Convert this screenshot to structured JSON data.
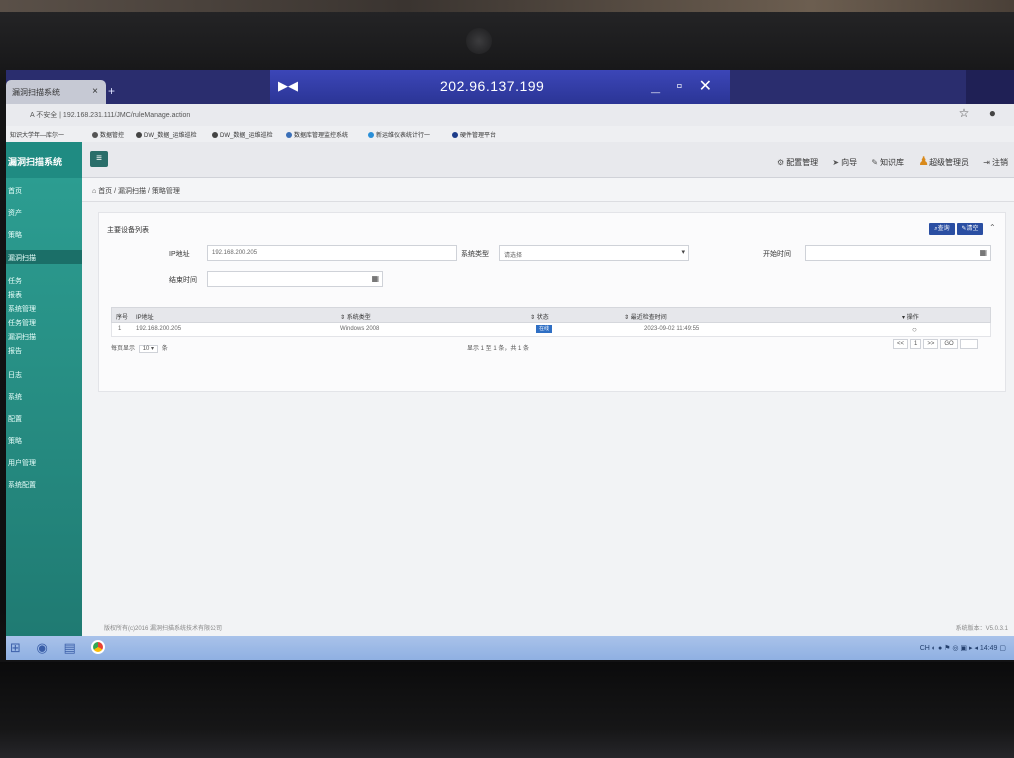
{
  "remote": {
    "ip": "202.96.137.199",
    "pin_icon": "pin-icon"
  },
  "browser": {
    "tab_title": "漏洞扫描系统",
    "url": "A 不安全 | 192.168.231.111/JMC/ruleManage.action",
    "bookmarks": [
      "知识大学年—库尔一",
      "数据管控",
      "DW_数据_运维巡检",
      "DW_数据_运维巡检",
      "数据库管理监控系统",
      "新运维仪表统计行一",
      "硬件管理平台"
    ]
  },
  "app": {
    "brand": "漏洞扫描系统",
    "header_links": [
      "配置管理",
      "向导",
      "知识库",
      "超级管理员",
      "注销"
    ],
    "breadcrumb": "首页 / 漏洞扫描 / 策略管理",
    "sidebar": [
      "首页",
      "资产",
      "策略",
      "漏洞扫描",
      "任务",
      "报表",
      "系统管理",
      "任务管理",
      "漏洞扫描",
      "报告",
      "日志",
      "系统",
      "配置",
      "策略",
      "用户管理",
      "系统配置"
    ]
  },
  "panel": {
    "title": "主要设备列表",
    "query_label": "查询",
    "clear_label": "清空",
    "ip_label": "IP地址",
    "ip_value": "192.168.200.205",
    "sys_label": "系统类型",
    "sys_value": "请选择",
    "start_label": "开始时间",
    "end_label": "结束时间"
  },
  "table": {
    "headers": [
      "序号",
      "IP地址",
      "系统类型",
      "状态",
      "最近检查时间",
      "操作"
    ],
    "rows": [
      {
        "no": "1",
        "ip": "192.168.200.205",
        "os": "Windows 2008",
        "status": "在线",
        "time": "2023-09-02 11:49:55",
        "op": "○"
      }
    ],
    "page_size_label": "每页显示",
    "page_size": "10",
    "page_unit": "条",
    "summary": "显示 1 至 1 条，共 1 条",
    "pager": [
      "<<",
      "1",
      ">>",
      "GO"
    ]
  },
  "footer": {
    "left": "版权所有(c)2016 漏洞扫描系统技术有限公司",
    "right": "系统版本：V5.0.3.1"
  },
  "tray": {
    "time": "14:49"
  }
}
